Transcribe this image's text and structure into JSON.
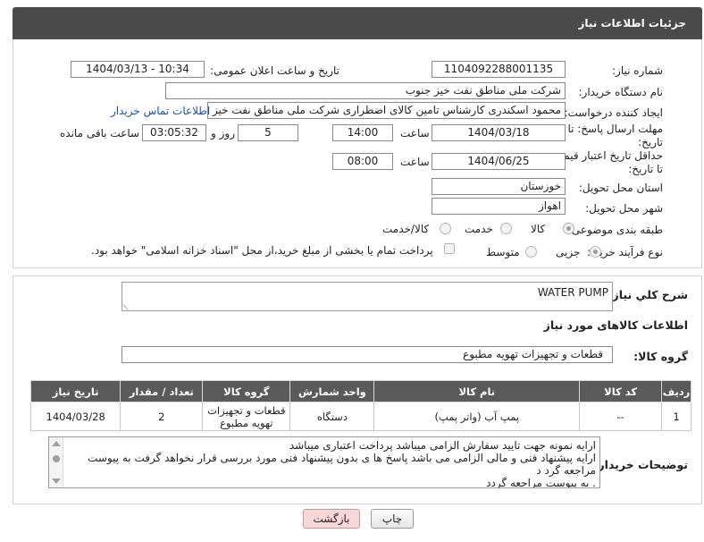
{
  "header": {
    "title": "جزئیات اطلاعات نیاز"
  },
  "fields": {
    "need_number_label": "شماره نیاز:",
    "need_number": "1104092288001135",
    "announce_label": "تاریخ و ساعت اعلان عمومی:",
    "announce_value": "1404/03/13 - 10:34",
    "buyer_org_label": "نام دستگاه خریدار:",
    "buyer_org": "شرکت ملی مناطق نفت خیز جنوب",
    "creator_label": "ایجاد کننده درخواست:",
    "creator": "محمود  اسکندری کارشناس تامین کالای اضطراری شرکت ملی مناطق نفت خیز",
    "contact_link": "اطلاعات تماس خریدار",
    "deadline_label_1": "مهلت ارسال پاسخ: تا",
    "deadline_label_2": "تاریخ:",
    "deadline_date": "1404/03/18",
    "time_label": "ساعت",
    "deadline_time": "14:00",
    "days_value": "5",
    "days_label": "روز و",
    "remaining_value": "03:05:32",
    "remaining_label": "ساعت باقی مانده",
    "validity_label_1": "حداقل تاریخ اعتبار قیمت:",
    "validity_label_2": "تا تاریخ:",
    "validity_date": "1404/06/25",
    "validity_time": "08:00",
    "province_label": "استان محل تحویل:",
    "province": "خوزستان",
    "city_label": "شهر محل تحویل:",
    "city": "اهواز",
    "category_label": "طبقه بندی موضوعی:",
    "category_options": [
      "کالا",
      "خدمت",
      "کالا/خدمت"
    ],
    "purchase_type_label": "نوع فرآیند خرید :",
    "purchase_options": [
      "جزیی",
      "متوسط"
    ],
    "payment_note": "پرداخت تمام یا بخشی از مبلغ خرید،از محل \"اسناد خزانه اسلامی\" خواهد بود."
  },
  "description": {
    "label": "شرح کلي نياز:",
    "value": "WATER PUMP"
  },
  "goods": {
    "section_title": "اطلاعات کالاهای مورد نیاز",
    "group_label": "گروه کالا:",
    "group_value": "قطعات و تجهیزات تهویه مطبوع",
    "columns": [
      "ردیف",
      "کد کالا",
      "نام کالا",
      "واحد شمارش",
      "گروه کالا",
      "تعداد / مقدار",
      "تاریخ نیاز"
    ],
    "rows": [
      [
        "1",
        "--",
        "پمپ آب (واتر پمپ)",
        "دستگاه",
        "قطعات و تجهیزات تهویه مطبوع",
        "2",
        "1404/03/28"
      ]
    ]
  },
  "notes": {
    "label": "توضیحات خریدار:",
    "lines": [
      "ارایه نمونه جهت تایید سفارش الزامی میباشد پرداخت اعتباری میباشد",
      "ارایه پیشنهاد فنی و مالی الزامی می باشد پاسخ ها ی بدون پیشنهاد فنی مورد بررسی قرار نخواهد گرفت به پیوست",
      "مراجعه گرد د",
      ". به پیوست مراجعه گردد"
    ]
  },
  "buttons": {
    "print": "چاپ",
    "back": "بازگشت"
  },
  "colors": {
    "header_bg": "#4a4a4a",
    "table_header_bg": "#5a5a5a",
    "link": "#1a4fb3",
    "back_button": "#f8d7d7"
  }
}
